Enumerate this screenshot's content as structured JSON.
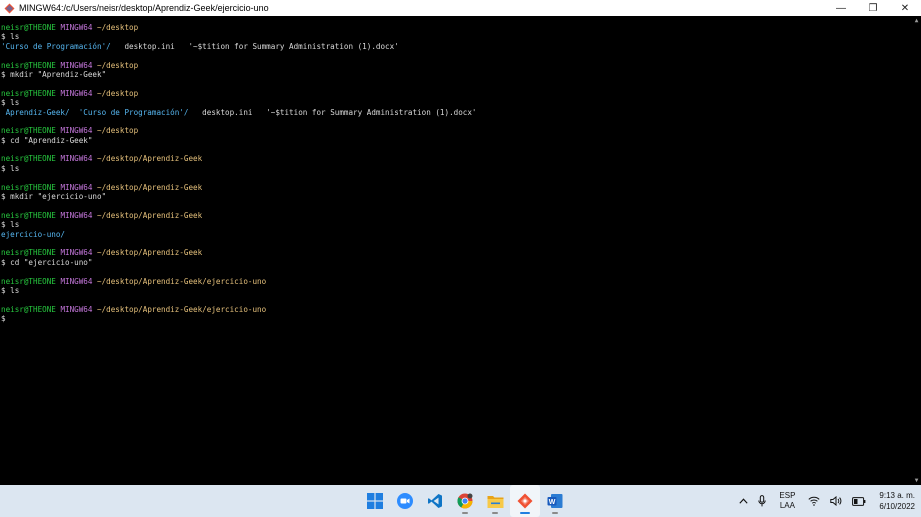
{
  "window": {
    "title": "MINGW64:/c/Users/neisr/desktop/Aprendiz-Geek/ejercicio-uno",
    "minimize_symbol": "—",
    "maximize_symbol": "❐",
    "close_symbol": "✕"
  },
  "terminal": {
    "lines": [
      [
        {
          "t": "neisr@THEONE",
          "c": "g"
        },
        {
          "t": " MINGW64",
          "c": "m"
        },
        {
          "t": " ~/desktop",
          "c": "y"
        }
      ],
      [
        {
          "t": "$ ls",
          "c": "w"
        }
      ],
      [
        {
          "t": "'Curso de Programación'/",
          "c": "c"
        },
        {
          "t": "   desktop.ini   '~$tition for Summary Administration (1).docx'",
          "c": "w"
        }
      ],
      [],
      [
        {
          "t": "neisr@THEONE",
          "c": "g"
        },
        {
          "t": " MINGW64",
          "c": "m"
        },
        {
          "t": " ~/desktop",
          "c": "y"
        }
      ],
      [
        {
          "t": "$ mkdir \"Aprendiz-Geek\"",
          "c": "w"
        }
      ],
      [],
      [
        {
          "t": "neisr@THEONE",
          "c": "g"
        },
        {
          "t": " MINGW64",
          "c": "m"
        },
        {
          "t": " ~/desktop",
          "c": "y"
        }
      ],
      [
        {
          "t": "$ ls",
          "c": "w"
        }
      ],
      [
        {
          "t": " Aprendiz-Geek/",
          "c": "c"
        },
        {
          "t": "  ",
          "c": "w"
        },
        {
          "t": "'Curso de Programación'/",
          "c": "c"
        },
        {
          "t": "   desktop.ini   '~$tition for Summary Administration (1).docx'",
          "c": "w"
        }
      ],
      [],
      [
        {
          "t": "neisr@THEONE",
          "c": "g"
        },
        {
          "t": " MINGW64",
          "c": "m"
        },
        {
          "t": " ~/desktop",
          "c": "y"
        }
      ],
      [
        {
          "t": "$ cd \"Aprendiz-Geek\"",
          "c": "w"
        }
      ],
      [],
      [
        {
          "t": "neisr@THEONE",
          "c": "g"
        },
        {
          "t": " MINGW64",
          "c": "m"
        },
        {
          "t": " ~/desktop/Aprendiz-Geek",
          "c": "y"
        }
      ],
      [
        {
          "t": "$ ls",
          "c": "w"
        }
      ],
      [],
      [
        {
          "t": "neisr@THEONE",
          "c": "g"
        },
        {
          "t": " MINGW64",
          "c": "m"
        },
        {
          "t": " ~/desktop/Aprendiz-Geek",
          "c": "y"
        }
      ],
      [
        {
          "t": "$ mkdir \"ejercicio-uno\"",
          "c": "w"
        }
      ],
      [],
      [
        {
          "t": "neisr@THEONE",
          "c": "g"
        },
        {
          "t": " MINGW64",
          "c": "m"
        },
        {
          "t": " ~/desktop/Aprendiz-Geek",
          "c": "y"
        }
      ],
      [
        {
          "t": "$ ls",
          "c": "w"
        }
      ],
      [
        {
          "t": "ejercicio-uno/",
          "c": "c"
        }
      ],
      [],
      [
        {
          "t": "neisr@THEONE",
          "c": "g"
        },
        {
          "t": " MINGW64",
          "c": "m"
        },
        {
          "t": " ~/desktop/Aprendiz-Geek",
          "c": "y"
        }
      ],
      [
        {
          "t": "$ cd \"ejercicio-uno\"",
          "c": "w"
        }
      ],
      [],
      [
        {
          "t": "neisr@THEONE",
          "c": "g"
        },
        {
          "t": " MINGW64",
          "c": "m"
        },
        {
          "t": " ~/desktop/Aprendiz-Geek/ejercicio-uno",
          "c": "y"
        }
      ],
      [
        {
          "t": "$ ls",
          "c": "w"
        }
      ],
      [],
      [
        {
          "t": "neisr@THEONE",
          "c": "g"
        },
        {
          "t": " MINGW64",
          "c": "m"
        },
        {
          "t": " ~/desktop/Aprendiz-Geek/ejercicio-uno",
          "c": "y"
        }
      ],
      [
        {
          "t": "$",
          "c": "w"
        }
      ]
    ]
  },
  "taskbar": {
    "apps": [
      {
        "name": "start-button",
        "icon": "windows-logo-icon",
        "active": false,
        "running": false
      },
      {
        "name": "zoom-app",
        "icon": "zoom-camera-icon",
        "active": false,
        "running": false
      },
      {
        "name": "vscode-app",
        "icon": "vscode-icon",
        "active": false,
        "running": false
      },
      {
        "name": "chrome-app",
        "icon": "chrome-icon",
        "active": false,
        "running": true
      },
      {
        "name": "file-explorer-app",
        "icon": "folder-icon",
        "active": false,
        "running": true
      },
      {
        "name": "git-bash-app",
        "icon": "git-icon",
        "active": true,
        "running": true
      },
      {
        "name": "word-app",
        "icon": "word-icon",
        "active": false,
        "running": true
      }
    ],
    "tray": {
      "chevron": "^",
      "lang_top": "ESP",
      "lang_bottom": "LAA",
      "time": "9:13 a. m.",
      "date": "6/10/2022"
    }
  },
  "colors": {
    "prompt_user": "#27c93f",
    "prompt_host": "#c678dd",
    "prompt_path": "#e5c07b",
    "directory": "#56b6f0",
    "text": "#d9d9d9",
    "taskbar_bg": "#dce6f1"
  }
}
